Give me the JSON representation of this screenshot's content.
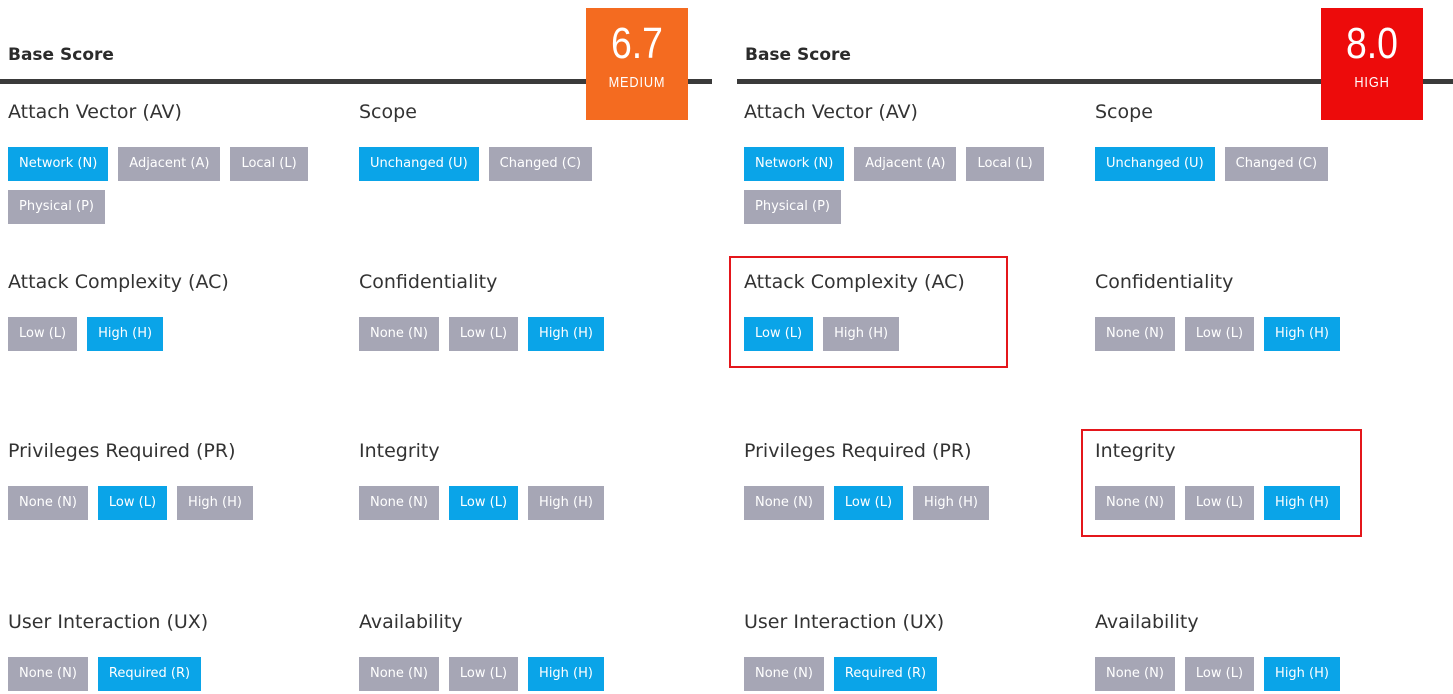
{
  "colors": {
    "selected": "#0aa4e8",
    "unselected": "#a6a6b5",
    "medium": "#f46b20",
    "high": "#ed0b0b",
    "highlight_border": "#e4161b"
  },
  "panels": [
    {
      "title": "Base Score",
      "score": "6.7",
      "severity": "MEDIUM",
      "metrics": [
        {
          "label": "Attach Vector (AV)",
          "options": [
            "Network (N)",
            "Adjacent (A)",
            "Local (L)",
            "Physical (P)"
          ],
          "selected": 0
        },
        {
          "label": "Scope",
          "options": [
            "Unchanged (U)",
            "Changed (C)"
          ],
          "selected": 0
        },
        {
          "label": "Attack Complexity (AC)",
          "options": [
            "Low (L)",
            "High (H)"
          ],
          "selected": 1
        },
        {
          "label": "Confidentiality",
          "options": [
            "None (N)",
            "Low (L)",
            "High (H)"
          ],
          "selected": 2
        },
        {
          "label": "Privileges Required (PR)",
          "options": [
            "None (N)",
            "Low (L)",
            "High (H)"
          ],
          "selected": 1
        },
        {
          "label": "Integrity",
          "options": [
            "None (N)",
            "Low (L)",
            "High (H)"
          ],
          "selected": 1
        },
        {
          "label": "User Interaction (UX)",
          "options": [
            "None (N)",
            "Required (R)"
          ],
          "selected": 1
        },
        {
          "label": "Availability",
          "options": [
            "None (N)",
            "Low (L)",
            "High (H)"
          ],
          "selected": 2
        }
      ]
    },
    {
      "title": "Base Score",
      "score": "8.0",
      "severity": "HIGH",
      "metrics": [
        {
          "label": "Attach Vector (AV)",
          "options": [
            "Network (N)",
            "Adjacent (A)",
            "Local (L)",
            "Physical (P)"
          ],
          "selected": 0
        },
        {
          "label": "Scope",
          "options": [
            "Unchanged (U)",
            "Changed (C)"
          ],
          "selected": 0
        },
        {
          "label": "Attack Complexity (AC)",
          "options": [
            "Low (L)",
            "High (H)"
          ],
          "selected": 0
        },
        {
          "label": "Confidentiality",
          "options": [
            "None (N)",
            "Low (L)",
            "High (H)"
          ],
          "selected": 2
        },
        {
          "label": "Privileges Required (PR)",
          "options": [
            "None (N)",
            "Low (L)",
            "High (H)"
          ],
          "selected": 1
        },
        {
          "label": "Integrity",
          "options": [
            "None (N)",
            "Low (L)",
            "High (H)"
          ],
          "selected": 2
        },
        {
          "label": "User Interaction (UX)",
          "options": [
            "None (N)",
            "Required (R)"
          ],
          "selected": 1
        },
        {
          "label": "Availability",
          "options": [
            "None (N)",
            "Low (L)",
            "High (H)"
          ],
          "selected": 2
        }
      ]
    }
  ]
}
